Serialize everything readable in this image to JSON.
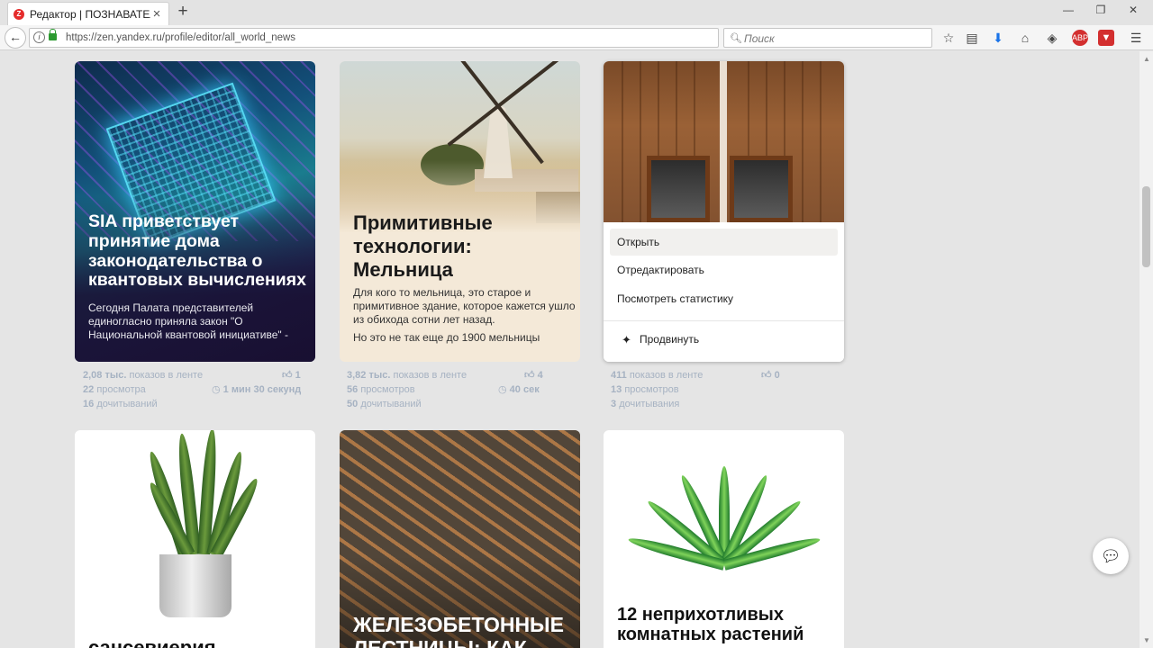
{
  "browser": {
    "tab_title": "Редактор | ПОЗНАВАТЕЛ...",
    "tab_favicon": "Z",
    "url": "https://zen.yandex.ru/profile/editor/all_world_news",
    "search_placeholder": "Поиск",
    "new_tab": "+",
    "close_tab": "×"
  },
  "cards": [
    {
      "title": "SIA приветствует принятие дома законодательства о квантовых вычислениях",
      "snippet": "Сегодня Палата представителей единогласно приняла закон \"О Национальной квантовой инициативе\" -",
      "stats": {
        "impressions_num": "2,08 тыс.",
        "impressions_label": "показов в ленте",
        "views_num": "22",
        "views_label": "просмотра",
        "reads_num": "16",
        "reads_label": "дочитываний",
        "likes": "1",
        "read_time": "1 мин 30 секунд"
      }
    },
    {
      "title": "Примитивные технологии: Мельница",
      "snippet": "Для кого то мельница, это старое и примитивное здание, которое кажется ушло из обихода сотни лет назад.",
      "snippet2": "Но это не так еще до 1900 мельницы",
      "stats": {
        "impressions_num": "3,82 тыс.",
        "impressions_label": "показов в ленте",
        "views_num": "56",
        "views_label": "просмотров",
        "reads_num": "50",
        "reads_label": "дочитываний",
        "likes": "4",
        "read_time": "40 сек"
      }
    },
    {
      "menu": {
        "open": "Открыть",
        "edit": "Отредактировать",
        "stats": "Посмотреть статистику",
        "promote": "Продвинуть"
      },
      "stats": {
        "impressions_num": "411",
        "impressions_label": "показов в ленте",
        "views_num": "13",
        "views_label": "просмотров",
        "reads_num": "3",
        "reads_label": "дочитывания",
        "likes": "0"
      }
    },
    {
      "title": "сансевиерия"
    },
    {
      "title": "ЖЕЛЕЗОБЕТОННЫЕ ЛЕСТНИЦЫ: КАК"
    },
    {
      "title": "12 неприхотливых комнатных растений"
    }
  ],
  "colors": {
    "page_bg": "#e5e5e5",
    "stats_text": "#a6b2c2",
    "menu_hover": "#f1f0ee"
  }
}
